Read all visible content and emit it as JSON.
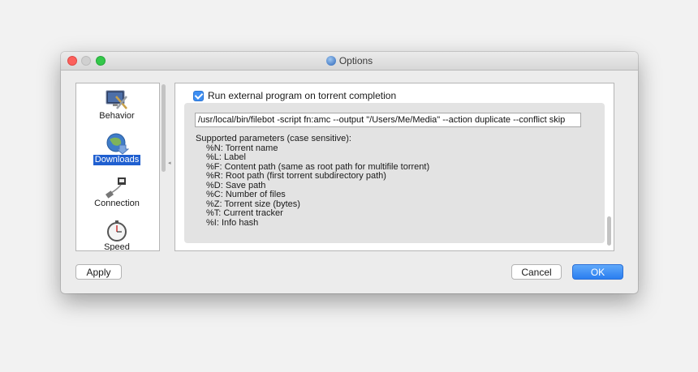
{
  "window": {
    "title": "Options"
  },
  "sidebar": {
    "items": [
      {
        "label": "Behavior",
        "icon": "behavior-icon"
      },
      {
        "label": "Downloads",
        "icon": "downloads-icon",
        "selected": true
      },
      {
        "label": "Connection",
        "icon": "connection-icon"
      },
      {
        "label": "Speed",
        "icon": "speed-icon"
      }
    ]
  },
  "downloads": {
    "run_external_label": "Run external program on torrent completion",
    "run_external_checked": true,
    "command_value": "/usr/local/bin/filebot -script fn:amc --output \"/Users/Me/Media\" --action duplicate --conflict skip",
    "params_heading": "Supported parameters (case sensitive):",
    "params": [
      "%N: Torrent name",
      "%L: Label",
      "%F: Content path (same as root path for multifile torrent)",
      "%R: Root path (first torrent subdirectory path)",
      "%D: Save path",
      "%C: Number of files",
      "%Z: Torrent size (bytes)",
      "%T: Current tracker",
      "%I: Info hash"
    ]
  },
  "buttons": {
    "apply": "Apply",
    "cancel": "Cancel",
    "ok": "OK"
  },
  "colors": {
    "accent": "#2a7ef0",
    "selection": "#1f5fd0"
  }
}
